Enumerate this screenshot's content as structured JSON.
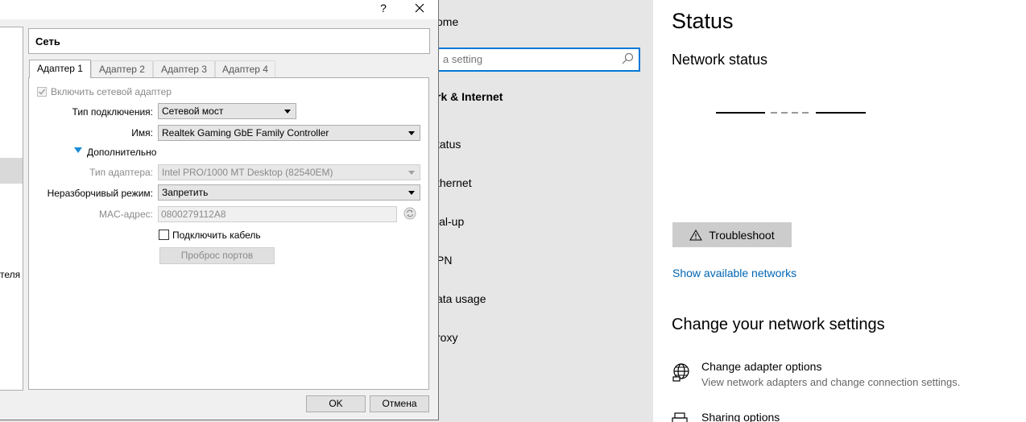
{
  "settings": {
    "nav": {
      "home": "ome",
      "search_placeholder": "a setting",
      "section": "rk & Internet",
      "items": [
        "tatus",
        "thernet",
        "ial-up",
        "PN",
        "ata usage",
        "roxy"
      ]
    },
    "content": {
      "title": "Status",
      "network_status": "Network status",
      "troubleshoot": "Troubleshoot",
      "show_networks": "Show available networks",
      "change_heading": "Change your network settings",
      "adapter_title": "Change adapter options",
      "adapter_desc": "View network adapters and change connection settings.",
      "sharing_title": "Sharing options"
    },
    "colors": {
      "accent": "#0078d7",
      "link": "#0066b4"
    }
  },
  "dialog": {
    "help": "?",
    "left_text": "теля",
    "section_title": "Сеть",
    "tabs": [
      "Адаптер 1",
      "Адаптер 2",
      "Адаптер 3",
      "Адаптер 4"
    ],
    "enable_adapter": "Включить сетевой адаптер",
    "conn_type_label": "Тип подключения:",
    "conn_type_value": "Сетевой мост",
    "name_label": "Имя:",
    "name_value": "Realtek Gaming GbE Family Controller",
    "advanced": "Дополнительно",
    "adapter_type_label": "Тип адаптера:",
    "adapter_type_value": "Intel PRO/1000 MT Desktop (82540EM)",
    "promisc_label": "Неразборчивый режим:",
    "promisc_value": "Запретить",
    "mac_label": "MAC-адрес:",
    "mac_value": "0800279112A8",
    "cable_label": "Подключить кабель",
    "port_forward": "Проброс портов",
    "ok": "OK",
    "cancel": "Отмена"
  }
}
